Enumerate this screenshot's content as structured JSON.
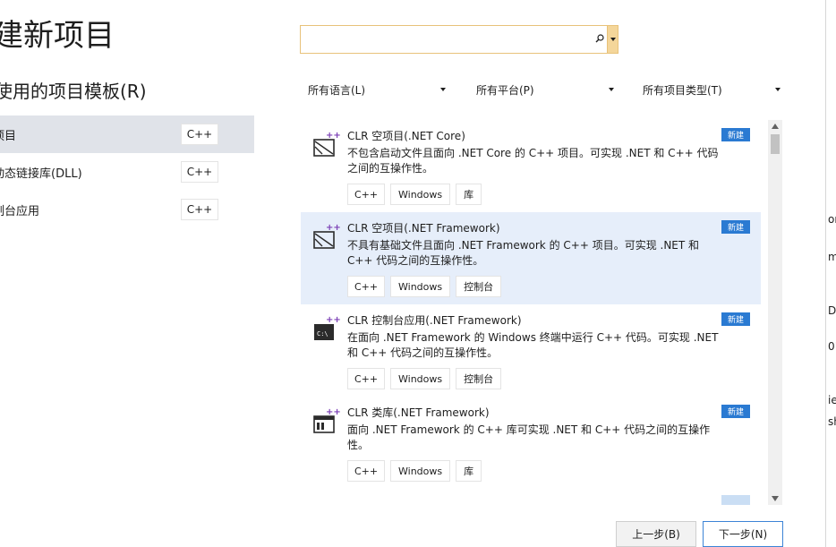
{
  "page_title": "建新项目",
  "recent": {
    "title": "使用的项目模板(R)",
    "items": [
      {
        "name": "项目",
        "lang": "C++"
      },
      {
        "name": "动态链接库(DLL)",
        "lang": "C++"
      },
      {
        "name": "制台应用",
        "lang": "C++"
      }
    ]
  },
  "search": {
    "value": "",
    "placeholder": ""
  },
  "filters": {
    "language": "所有语言(L)",
    "platform": "所有平台(P)",
    "project_type": "所有项目类型(T)"
  },
  "templates": [
    {
      "name": "CLR 空项目(.NET Core)",
      "badge": "新建",
      "description": "不包含启动文件且面向 .NET Core 的 C++ 项目。可实现 .NET 和 C++ 代码之间的互操作性。",
      "tags": [
        "C++",
        "Windows",
        "库"
      ]
    },
    {
      "name": "CLR 空项目(.NET Framework)",
      "badge": "新建",
      "description": "不具有基础文件且面向 .NET Framework 的 C++ 项目。可实现 .NET 和 C++ 代码之间的互操作性。",
      "tags": [
        "C++",
        "Windows",
        "控制台"
      ]
    },
    {
      "name": "CLR 控制台应用(.NET Framework)",
      "badge": "新建",
      "description": "在面向 .NET Framework 的 Windows 终端中运行 C++ 代码。可实现 .NET 和 C++ 代码之间的互操作性。",
      "tags": [
        "C++",
        "Windows",
        "控制台"
      ]
    },
    {
      "name": "CLR 类库(.NET Framework)",
      "badge": "新建",
      "description": "面向 .NET Framework 的 C++ 库可实现 .NET 和 C++ 代码之间的互操作性。",
      "tags": [
        "C++",
        "Windows",
        "库"
      ]
    }
  ],
  "buttons": {
    "back": "上一步(B)",
    "next": "下一步(N)"
  },
  "side_fragments": [
    "on",
    "m",
    "D",
    "01",
    "ie",
    "sh"
  ],
  "colors": {
    "accent": "#2a7ad2",
    "search_border": "#e8c27a",
    "selected_item": "#e6eefa"
  }
}
